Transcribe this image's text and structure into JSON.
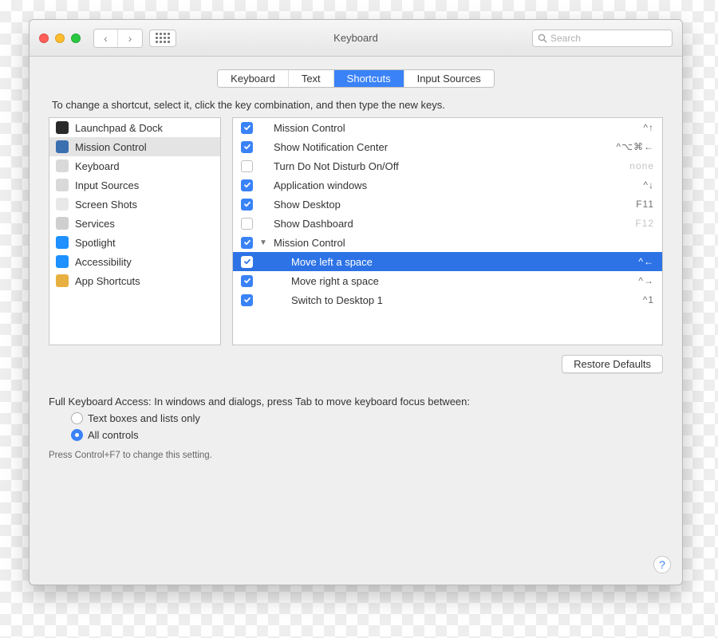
{
  "window": {
    "title": "Keyboard"
  },
  "search": {
    "placeholder": "Search"
  },
  "tabs": [
    "Keyboard",
    "Text",
    "Shortcuts",
    "Input Sources"
  ],
  "instruction": "To change a shortcut, select it, click the key combination, and then type the new keys.",
  "categories": [
    {
      "label": "Launchpad & Dock",
      "icon_bg": "#2a2a2a"
    },
    {
      "label": "Mission Control",
      "icon_bg": "#3a6fb0"
    },
    {
      "label": "Keyboard",
      "icon_bg": "#d9d9d9"
    },
    {
      "label": "Input Sources",
      "icon_bg": "#d9d9d9"
    },
    {
      "label": "Screen Shots",
      "icon_bg": "#e8e8e8"
    },
    {
      "label": "Services",
      "icon_bg": "#cfcfcf"
    },
    {
      "label": "Spotlight",
      "icon_bg": "#1e90ff"
    },
    {
      "label": "Accessibility",
      "icon_bg": "#1e90ff"
    },
    {
      "label": "App Shortcuts",
      "icon_bg": "#e8b040"
    }
  ],
  "shortcuts": [
    {
      "label": "Mission Control",
      "shortcut": "^↑",
      "checked": true
    },
    {
      "label": "Show Notification Center",
      "shortcut": "^⌥⌘←",
      "checked": true
    },
    {
      "label": "Turn Do Not Disturb On/Off",
      "shortcut": "none",
      "checked": false,
      "dim": true
    },
    {
      "label": "Application windows",
      "shortcut": "^↓",
      "checked": true
    },
    {
      "label": "Show Desktop",
      "shortcut": "F11",
      "checked": true
    },
    {
      "label": "Show Dashboard",
      "shortcut": "F12",
      "checked": false,
      "dim": true
    },
    {
      "label": "Mission Control",
      "shortcut": "",
      "checked": true,
      "group": true
    },
    {
      "label": "Move left a space",
      "shortcut": "^←",
      "checked": true,
      "indent": true,
      "selected": true
    },
    {
      "label": "Move right a space",
      "shortcut": "^→",
      "checked": true,
      "indent": true
    },
    {
      "label": "Switch to Desktop 1",
      "shortcut": "^1",
      "checked": true,
      "indent": true
    }
  ],
  "restore": "Restore Defaults",
  "fka": {
    "heading": "Full Keyboard Access: In windows and dialogs, press Tab to move keyboard focus between:",
    "opt1": "Text boxes and lists only",
    "opt2": "All controls",
    "hint": "Press Control+F7 to change this setting."
  },
  "help": "?"
}
